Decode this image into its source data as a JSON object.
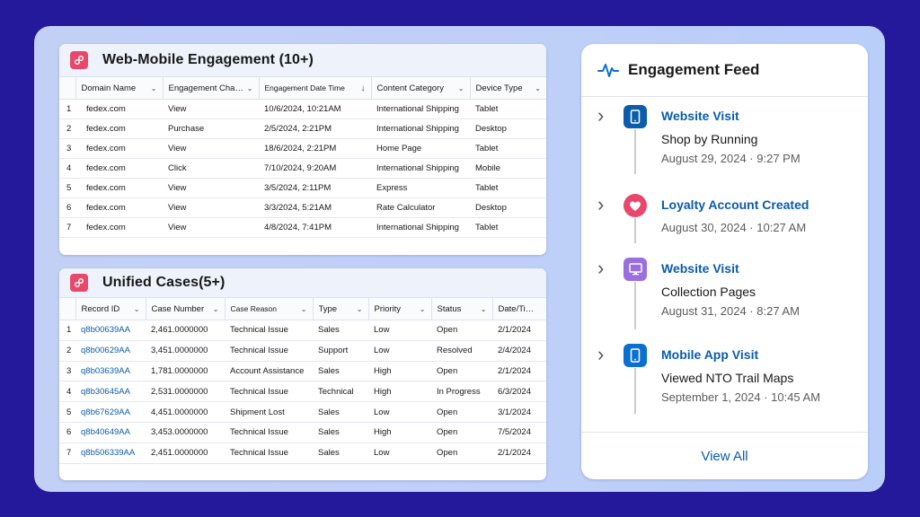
{
  "web_card": {
    "title": "Web-Mobile Engagement (10+)",
    "columns": [
      "Domain Name",
      "Engagement Chan...",
      "Engagement Date Time",
      "Content Category",
      "Device Type"
    ],
    "rows": [
      {
        "n": "1",
        "domain": "fedex.com",
        "channel": "View",
        "date": "10/6/2024, 10:21AM",
        "category": "International Shipping",
        "device": "Tablet"
      },
      {
        "n": "2",
        "domain": "fedex.com",
        "channel": "Purchase",
        "date": "2/5/2024, 2:21PM",
        "category": "International Shipping",
        "device": "Desktop"
      },
      {
        "n": "3",
        "domain": "fedex.com",
        "channel": "View",
        "date": "18/6/2024, 2:21PM",
        "category": "Home Page",
        "device": "Tablet"
      },
      {
        "n": "4",
        "domain": "fedex.com",
        "channel": "Click",
        "date": "7/10/2024, 9:20AM",
        "category": "International Shipping",
        "device": "Mobile"
      },
      {
        "n": "5",
        "domain": "fedex.com",
        "channel": "View",
        "date": "3/5/2024, 2:11PM",
        "category": "Express",
        "device": "Tablet"
      },
      {
        "n": "6",
        "domain": "fedex.com",
        "channel": "View",
        "date": "3/3/2024, 5:21AM",
        "category": "Rate Calculator",
        "device": "Desktop"
      },
      {
        "n": "7",
        "domain": "fedex.com",
        "channel": "View",
        "date": "4/8/2024, 7:41PM",
        "category": "International Shipping",
        "device": "Tablet"
      }
    ]
  },
  "cases_card": {
    "title": "Unified Cases(5+)",
    "columns": [
      "Record ID",
      "Case Number",
      "Case Reason",
      "Type",
      "Priority",
      "Status",
      "Date/Time..."
    ],
    "rows": [
      {
        "n": "1",
        "id": "q8b00639AA",
        "number": "2,461.0000000",
        "reason": "Technical Issue",
        "type": "Sales",
        "priority": "Low",
        "status": "Open",
        "date": "2/1/2024"
      },
      {
        "n": "2",
        "id": "q8b00629AA",
        "number": "3,451.0000000",
        "reason": "Technical Issue",
        "type": "Support",
        "priority": "Low",
        "status": "Resolved",
        "date": "2/4/2024"
      },
      {
        "n": "3",
        "id": "q8b03639AA",
        "number": "1,781.0000000",
        "reason": "Account Assistance",
        "type": "Sales",
        "priority": "High",
        "status": "Open",
        "date": "2/1/2024"
      },
      {
        "n": "4",
        "id": "q8b30645AA",
        "number": "2,531.0000000",
        "reason": "Technical Issue",
        "type": "Technical",
        "priority": "High",
        "status": "In Progress",
        "date": "6/3/2024"
      },
      {
        "n": "5",
        "id": "q8b67629AA",
        "number": "4,451.0000000",
        "reason": "Shipment Lost",
        "type": "Sales",
        "priority": "Low",
        "status": "Open",
        "date": "3/1/2024"
      },
      {
        "n": "6",
        "id": "q8b40649AA",
        "number": "3,453.0000000",
        "reason": "Technical Issue",
        "type": "Sales",
        "priority": "High",
        "status": "Open",
        "date": "7/5/2024"
      },
      {
        "n": "7",
        "id": "q8b506339AA",
        "number": "2,451.0000000",
        "reason": "Technical Issue",
        "type": "Sales",
        "priority": "Low",
        "status": "Open",
        "date": "2/1/2024"
      }
    ]
  },
  "feed": {
    "title": "Engagement Feed",
    "items": [
      {
        "title": "Website Visit",
        "subtitle": "Shop by Running",
        "date": "August 29, 2024 · 9:27 PM",
        "icon": "mobile-icon",
        "color": "#0b5cab"
      },
      {
        "title": "Loyalty Account Created",
        "subtitle": "",
        "date": "August 30, 2024 · 10:27 AM",
        "icon": "heart-icon",
        "color": "#e8486b"
      },
      {
        "title": "Website Visit",
        "subtitle": "Collection Pages",
        "date": "August 31, 2024 · 8:27 AM",
        "icon": "desktop-icon",
        "color": "#9b6ee0"
      },
      {
        "title": "Mobile App Visit",
        "subtitle": "Viewed NTO Trail Maps",
        "date": "September 1, 2024 · 10:45 AM",
        "icon": "mobile-icon",
        "color": "#0b6fd0"
      }
    ],
    "view_all": "View All"
  }
}
